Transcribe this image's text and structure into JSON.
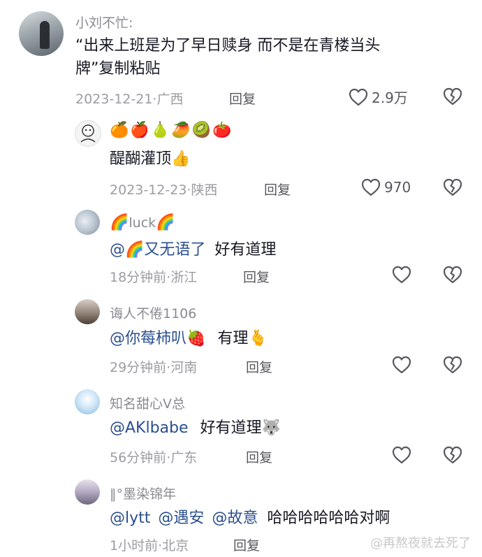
{
  "comments": [
    {
      "username": "小刘不忙:",
      "text_line1": "“出来上班是为了早日赎身 而不是在青楼当头",
      "text_line2": "牌”复制粘贴",
      "date": "2023-12-21",
      "location": "广西",
      "reply_label": "回复",
      "likes": "2.9万"
    },
    {
      "username_emojis": "🍊🍎🍐🥭🥝🍅",
      "text": "醍醐灌顶",
      "text_emoji": "👍",
      "date": "2023-12-23",
      "location": "陕西",
      "reply_label": "回复",
      "likes": "970"
    },
    {
      "username_prefix": "🌈",
      "username": "luck",
      "username_suffix": "🌈",
      "mention": "@🌈又无语了",
      "text": "好有道理",
      "date": "18分钟前",
      "location": "浙江",
      "reply_label": "回复"
    },
    {
      "username": "诲人不倦1106",
      "mention": "@你莓柿叭",
      "mention_emoji": "🍓",
      "text": "有理",
      "text_emoji": "🫰",
      "date": "29分钟前",
      "location": "河南",
      "reply_label": "回复"
    },
    {
      "username": "知名甜心V总",
      "mention": "@AKlbabe",
      "text": "好有道理",
      "text_emoji": "🐺",
      "date": "56分钟前",
      "location": "广东",
      "reply_label": "回复"
    },
    {
      "username": "‖°墨染锦年",
      "mentions": [
        "@lytt",
        "@遇安",
        "@故意"
      ],
      "text": "哈哈哈哈哈哈对啊",
      "date": "1小时前",
      "location": "北京",
      "reply_label": "回复"
    }
  ],
  "meta_separator": "·",
  "watermark": "@再熬夜就去死了",
  "colors": {
    "text": "#161823",
    "username": "#8a8b91",
    "meta": "#9b9ca1",
    "mention": "#2a4f8f",
    "icon": "#57585e"
  }
}
